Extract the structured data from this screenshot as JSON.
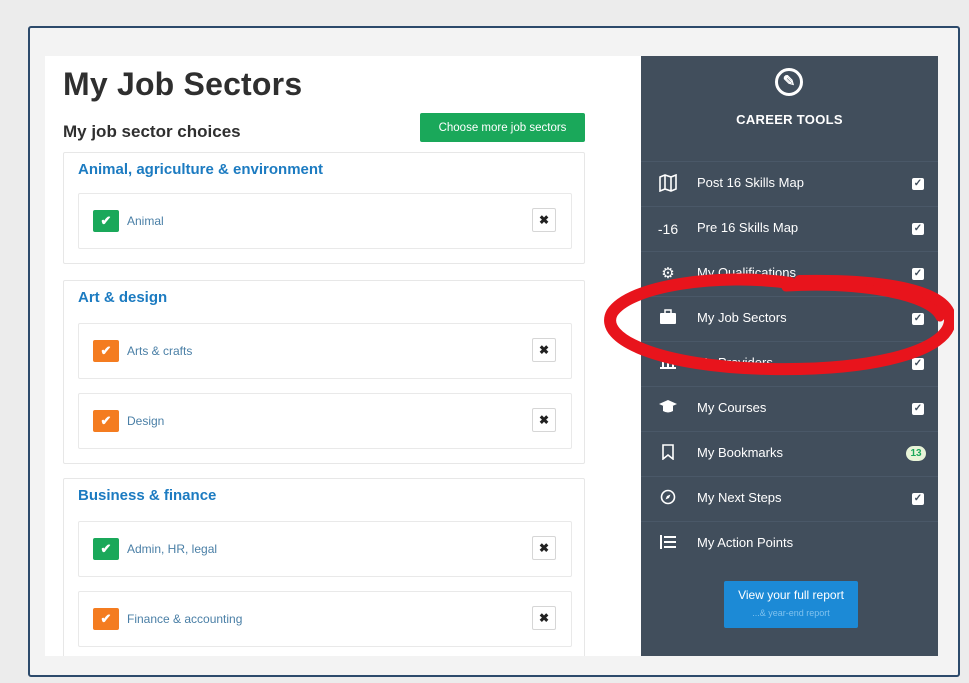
{
  "main": {
    "title": "My Job Sectors",
    "subtitle": "My job sector choices",
    "choose_button": "Choose more job sectors",
    "remove_icon": "close-icon",
    "categories": [
      {
        "title": "Animal, agriculture & environment",
        "sectors": [
          {
            "label": "Animal",
            "status_color": "#1aa85a"
          }
        ]
      },
      {
        "title": "Art & design",
        "sectors": [
          {
            "label": "Arts & crafts",
            "status_color": "#f47c20"
          },
          {
            "label": "Design",
            "status_color": "#f47c20"
          }
        ]
      },
      {
        "title": "Business & finance",
        "sectors": [
          {
            "label": "Admin, HR, legal",
            "status_color": "#1aa85a"
          },
          {
            "label": "Finance & accounting",
            "status_color": "#f47c20"
          }
        ]
      }
    ]
  },
  "sidebar": {
    "title": "CAREER TOOLS",
    "items": [
      {
        "label": "Post 16 Skills Map",
        "icon": "map-icon",
        "checked": true
      },
      {
        "label": "Pre 16 Skills Map",
        "icon": "pre16-icon",
        "icon_text": "-16",
        "checked": true
      },
      {
        "label": "My Qualifications",
        "icon": "gear-icon",
        "checked": true
      },
      {
        "label": "My Job Sectors",
        "icon": "briefcase-icon",
        "checked": true
      },
      {
        "label": "My Providers",
        "icon": "building-icon",
        "checked": true
      },
      {
        "label": "My Courses",
        "icon": "graduation-cap-icon",
        "checked": true
      },
      {
        "label": "My Bookmarks",
        "icon": "bookmark-icon",
        "badge": "13"
      },
      {
        "label": "My Next Steps",
        "icon": "compass-icon",
        "checked": true
      },
      {
        "label": "My Action Points",
        "icon": "list-icon"
      }
    ],
    "report_button": {
      "label": "View your full report",
      "sublabel": "...& year-end report"
    }
  },
  "annotation": {
    "color": "#e8141c"
  },
  "colors": {
    "accent_green": "#1aa85a",
    "accent_orange": "#f47c20",
    "link_blue": "#1c7bc1",
    "sidebar_bg": "#414e5c"
  }
}
